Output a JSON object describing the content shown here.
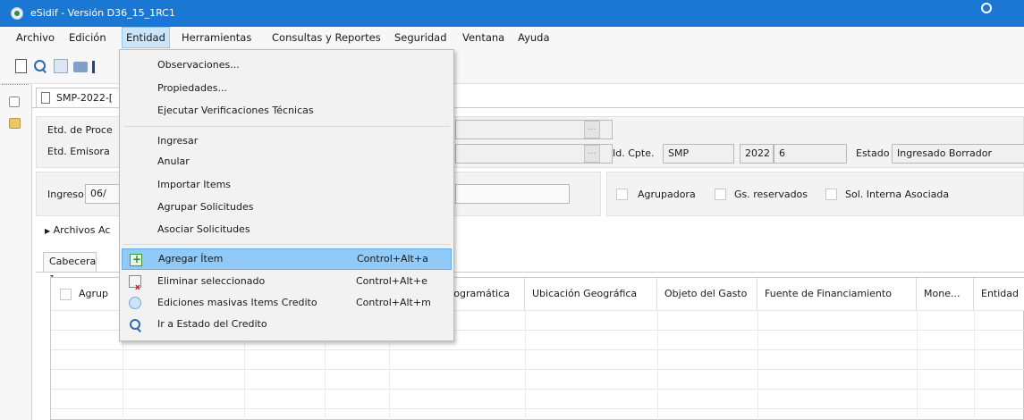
{
  "window": {
    "title": "eSidif - Versión D36_15_1RC1"
  },
  "menubar": {
    "items": [
      {
        "label": "Archivo"
      },
      {
        "label": "Edición"
      },
      {
        "label": "Entidad"
      },
      {
        "label": "Herramientas"
      },
      {
        "label": "Consultas y Reportes"
      },
      {
        "label": "Seguridad"
      },
      {
        "label": "Ventana"
      },
      {
        "label": "Ayuda"
      }
    ]
  },
  "toolbar": {
    "icons": [
      "new-document-icon",
      "search-icon",
      "save-icon",
      "print-icon"
    ]
  },
  "document_tab": {
    "label": "SMP-2022-["
  },
  "form": {
    "etd_proceso_label": "Etd. de Proce",
    "etd_emisora_label": "Etd. Emisora",
    "id_cpte_label": "Id. Cpte.",
    "id_cpte_type": "SMP",
    "id_cpte_year": "2022",
    "id_cpte_number": "6",
    "estado_label": "Estado",
    "estado_value": "Ingresado Borrador",
    "ingreso_label": "Ingreso",
    "ingreso_value": "06/",
    "agrupadora_label": "Agrupadora",
    "gs_reservados_label": "Gs. reservados",
    "sol_interna_label": "Sol. Interna Asociada",
    "archivos_label": "Archivos Ac"
  },
  "inner_tab": {
    "label": "Cabecera 1"
  },
  "table": {
    "first_header": "Agrup",
    "headers": [
      "rogramática",
      "Ubicación Geográfica",
      "Objeto del Gasto",
      "Fuente de Financiamiento",
      "Mone...",
      "Entidad"
    ]
  },
  "dropdown": {
    "group1": [
      {
        "label": "Observaciones..."
      },
      {
        "label": "Propiedades..."
      },
      {
        "label": "Ejecutar Verificaciones Técnicas"
      }
    ],
    "group2": [
      {
        "label": "Ingresar"
      },
      {
        "label": "Anular"
      },
      {
        "label": "Importar Items"
      },
      {
        "label": "Agrupar Solicitudes"
      },
      {
        "label": "Asociar Solicitudes"
      }
    ],
    "group3": [
      {
        "label": "Agregar Ítem",
        "shortcut": "Control+Alt+a",
        "icon": "add-item-icon",
        "highlighted": true
      },
      {
        "label": "Eliminar seleccionado",
        "shortcut": "Control+Alt+e",
        "icon": "delete-item-icon"
      },
      {
        "label": "Ediciones masivas Items Credito",
        "shortcut": "Control+Alt+m",
        "icon": "bulk-edit-icon"
      },
      {
        "label": "Ir a Estado del Credito",
        "shortcut": "",
        "icon": "go-to-status-icon"
      }
    ]
  },
  "colors": {
    "titlebar": "#1a78d4",
    "menu_highlight": "#91c9f7",
    "active_menu": "#cce4f7"
  }
}
